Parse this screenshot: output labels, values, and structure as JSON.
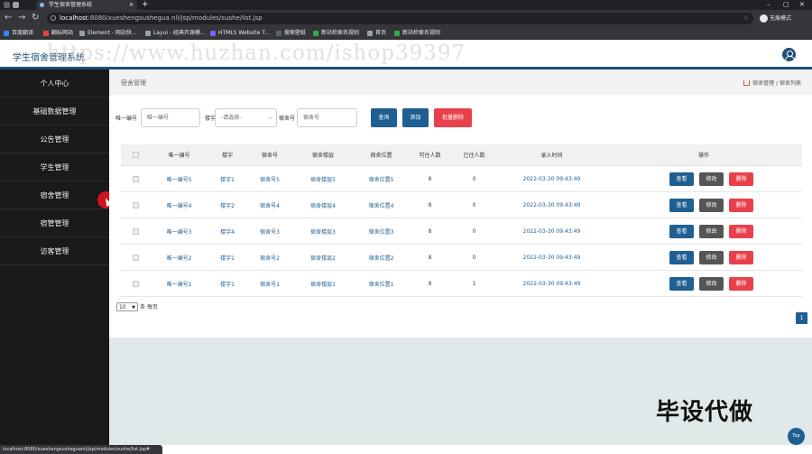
{
  "browser": {
    "tab_title": "学生宿舍管理系统",
    "url_host": "localhost",
    "url_rest": ":8080/xueshengsushegua nli/jsp/modules/sushe/list.jsp",
    "profile_label": "无痕模式",
    "bookmarks": [
      "百度翻译",
      "翻标网站",
      "Element - 网站快...",
      "Layui - 经典开源模...",
      "HTML5 Website T...",
      "搜索壁纸",
      "新站检索名规则",
      "首页",
      "新站检索名规则"
    ],
    "status_url": "localhost:8080/xueshengsusheguanli/jsp/modules/sushe/list.jsp#"
  },
  "header": {
    "app_title": "学生宿舍管理系统",
    "watermark": "https://www.huzhan.com/ishop39397"
  },
  "sidebar": {
    "items": [
      "个人中心",
      "基础数据管理",
      "公告管理",
      "学生管理",
      "宿舍管理",
      "宿管管理",
      "访客管理"
    ]
  },
  "main": {
    "heading": "宿舍管理",
    "breadcrumb": [
      "宿舍管理",
      "宿舍列表"
    ],
    "breadcrumb_sep": "/",
    "search": {
      "label_number": "唯一编号",
      "placeholder_number": "唯一编号",
      "label_building": "楼宇",
      "select_building": "-请选择-",
      "label_room": "宿舍号",
      "placeholder_room": "宿舍号",
      "btn_query": "查询",
      "btn_add": "添加",
      "btn_batch_delete": "批量删除"
    },
    "table": {
      "headers": [
        "唯一编号",
        "楼宇",
        "宿舍号",
        "宿舍楼层",
        "宿舍位置",
        "可住人数",
        "已住人数",
        "录入时间",
        "操作"
      ],
      "rows": [
        {
          "number": "唯一编号5",
          "building": "楼宇1",
          "room": "宿舍号5",
          "floor": "宿舍楼层5",
          "position": "宿舍位置5",
          "capacity": "8",
          "occupied": "0",
          "time": "2022-03-30 09:43:49"
        },
        {
          "number": "唯一编号4",
          "building": "楼宇2",
          "room": "宿舍号4",
          "floor": "宿舍楼层4",
          "position": "宿舍位置4",
          "capacity": "8",
          "occupied": "0",
          "time": "2022-03-30 09:43:49"
        },
        {
          "number": "唯一编号3",
          "building": "楼宇4",
          "room": "宿舍号3",
          "floor": "宿舍楼层3",
          "position": "宿舍位置3",
          "capacity": "8",
          "occupied": "0",
          "time": "2022-03-30 09:43:49"
        },
        {
          "number": "唯一编号2",
          "building": "楼宇1",
          "room": "宿舍号2",
          "floor": "宿舍楼层2",
          "position": "宿舍位置2",
          "capacity": "8",
          "occupied": "0",
          "time": "2022-03-30 09:43:49"
        },
        {
          "number": "唯一编号1",
          "building": "楼宇1",
          "room": "宿舍号1",
          "floor": "宿舍楼层1",
          "position": "宿舍位置1",
          "capacity": "8",
          "occupied": "1",
          "time": "2022-03-30 09:43:49"
        }
      ],
      "action_view": "查看",
      "action_edit": "修改",
      "action_delete": "删除"
    },
    "pager": {
      "page_size": "10",
      "per_page_label": "条 每页",
      "current_page": "1"
    }
  },
  "overlay": {
    "biye_text": "毕设代做",
    "top_button": "Top"
  },
  "colors": {
    "primary": "#1f5f91",
    "danger": "#e9414c",
    "neutral": "#555555",
    "sidebar": "#1a1a1a"
  }
}
